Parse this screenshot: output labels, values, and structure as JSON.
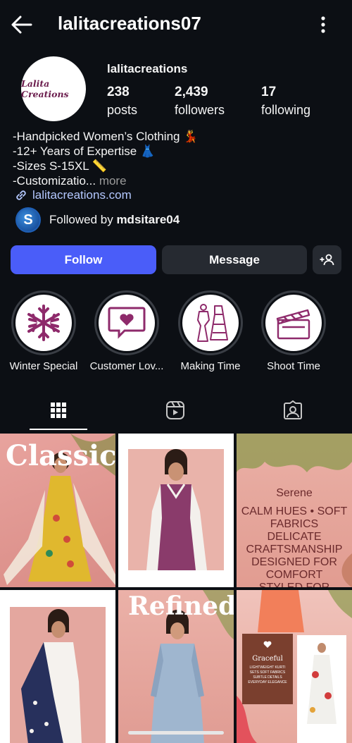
{
  "header": {
    "username": "lalitacreations07",
    "back_icon": "arrow-left-icon",
    "menu_icon": "more-vertical-icon"
  },
  "profile": {
    "avatar_text": "Lalita Creations",
    "display_name": "lalitacreations",
    "stats": [
      {
        "value": "238",
        "label": "posts"
      },
      {
        "value": "2,439",
        "label": "followers"
      },
      {
        "value": "17",
        "label": "following"
      }
    ],
    "bio": {
      "line1": "-Handpicked Women’s Clothing 💃",
      "line2": "-12+ Years of Expertise 👗",
      "line3": "-Sizes S-15XL 📏",
      "line4": "-Customizatio...",
      "more": " more"
    },
    "link": "lalitacreations.com",
    "followed_by_prefix": "Followed by ",
    "followed_by_user": "mdsitare04",
    "followed_avatar_letter": "S"
  },
  "actions": {
    "follow": "Follow",
    "message": "Message",
    "add_user_icon": "add-person-icon"
  },
  "highlights": [
    {
      "label": "Winter Special",
      "icon": "snowflake-icon"
    },
    {
      "label": "Customer Lov...",
      "icon": "heart-message-icon"
    },
    {
      "label": "Making Time",
      "icon": "mannequin-icon"
    },
    {
      "label": "Shoot Time",
      "icon": "clapperboard-icon"
    }
  ],
  "tabs": [
    {
      "name": "posts",
      "icon": "grid-icon",
      "active": true
    },
    {
      "name": "reels",
      "icon": "reels-icon",
      "active": false
    },
    {
      "name": "tagged",
      "icon": "tagged-icon",
      "active": false
    }
  ],
  "posts": {
    "p1_title": "Classic",
    "p3_title": "Serene",
    "p3_lines": [
      "CALM HUES • SOFT FABRICS",
      "DELICATE CRAFTSMANSHIP",
      "DESIGNED FOR COMFORT",
      "STYLED FOR ELEGANCE"
    ],
    "p5_title": "Refined",
    "p6_title": "Graceful",
    "p6_lines": [
      "LIGHTWEIGHT KURTI",
      "SETS SOFT FABRICS",
      "SUBTLE DETAILS",
      "EVERYDAY ELEGANCE"
    ]
  },
  "colors": {
    "background": "#0c0f14",
    "follow_button": "#4a5df9",
    "secondary_button": "#262a31",
    "link": "#b4c8ff",
    "brand": "#8e2a6b"
  }
}
